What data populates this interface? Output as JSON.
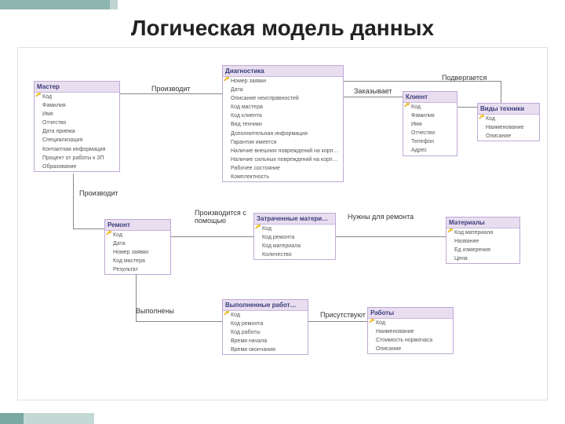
{
  "title": "Логическая модель данных",
  "entities": {
    "master": {
      "name": "Мастер",
      "fields": [
        "Код",
        "Фамилия",
        "Имя",
        "Отчество",
        "Дата приема",
        "Специализация",
        "Контактная информация",
        "Процент от работы к ЗП",
        "Образование"
      ]
    },
    "diag": {
      "name": "Диагностика",
      "fields": [
        "Номер заявки",
        "Дата",
        "Описание неисправностей",
        "Код мастера",
        "Код клиента",
        "Вид техники",
        "Дополнительная информация",
        "Гарантия имеется",
        "Наличие внешних повреждений на корпусе",
        "Наличие сильных повреждений на корпусе",
        "Рабочее состояние",
        "Комплектность"
      ]
    },
    "client": {
      "name": "Клиент",
      "fields": [
        "Код",
        "Фамилия",
        "Имя",
        "Отчество",
        "Телефон",
        "Адрес"
      ]
    },
    "tech": {
      "name": "Виды техники",
      "fields": [
        "Код",
        "Наименование",
        "Описание"
      ]
    },
    "repair": {
      "name": "Ремонт",
      "fields": [
        "Код",
        "Дата",
        "Номер заявки",
        "Код мастера",
        "Результат"
      ]
    },
    "usedmat": {
      "name": "Затраченные матери…",
      "fields": [
        "Код",
        "Код ремонта",
        "Код материала",
        "Количество"
      ]
    },
    "materials": {
      "name": "Материалы",
      "fields": [
        "Код материала",
        "Название",
        "Ед измерения",
        "Цена"
      ]
    },
    "donework": {
      "name": "Выполненные работ…",
      "fields": [
        "Код",
        "Код ремонта",
        "Код работы",
        "Время начала",
        "Время окончания"
      ]
    },
    "works": {
      "name": "Работы",
      "fields": [
        "Код",
        "Наименование",
        "Стоимость нормочаса",
        "Описание"
      ]
    }
  },
  "labels": {
    "produces1": "Производит",
    "produces2": "Производит",
    "orders": "Заказывает",
    "subjected": "Подвергается",
    "madewith": "Производится с помощью",
    "neededfor": "Нужны для ремонта",
    "done": "Выполнены",
    "present": "Присутствуют"
  }
}
